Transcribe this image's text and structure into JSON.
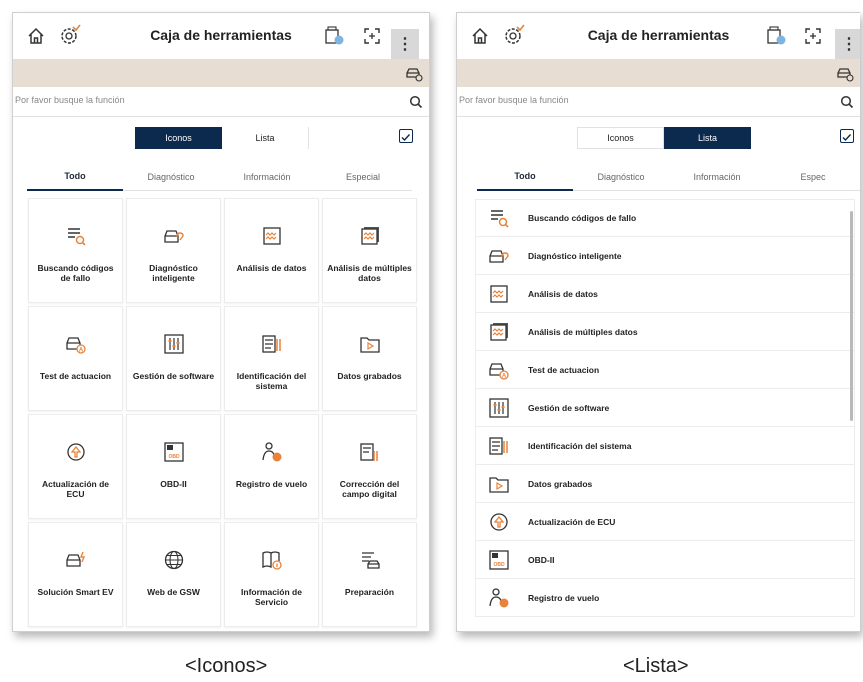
{
  "app": {
    "title": "Caja de herramientas",
    "more_label": "⋮",
    "search_placeholder": "Por favor busque la función"
  },
  "view_toggle": {
    "icons_label": "Iconos",
    "list_label": "Lista"
  },
  "categories": [
    "Todo",
    "Diagnóstico",
    "Información",
    "Especial"
  ],
  "categories_list_view": [
    "Todo",
    "Diagnóstico",
    "Información",
    "Espec"
  ],
  "tools_grid": [
    {
      "label": "Buscando códigos de fallo",
      "icon": "fault-code-search-icon"
    },
    {
      "label": "Diagnóstico inteligente",
      "icon": "smart-diagnosis-icon"
    },
    {
      "label": "Análisis de datos",
      "icon": "data-analysis-icon"
    },
    {
      "label": "Análisis de múltiples datos",
      "icon": "multi-data-icon"
    },
    {
      "label": "Test de actuacion",
      "icon": "actuation-test-icon"
    },
    {
      "label": "Gestión de software",
      "icon": "software-management-icon"
    },
    {
      "label": "Identificación del sistema",
      "icon": "system-id-icon"
    },
    {
      "label": "Datos grabados",
      "icon": "recorded-data-icon"
    },
    {
      "label": "Actualización de ECU",
      "icon": "ecu-update-icon"
    },
    {
      "label": "OBD-II",
      "icon": "obd-icon"
    },
    {
      "label": "Registro de vuelo",
      "icon": "flight-record-icon"
    },
    {
      "label": "Corrección del campo digital",
      "icon": "digital-field-icon"
    },
    {
      "label": "Solución Smart EV",
      "icon": "smart-ev-icon"
    },
    {
      "label": "Web de GSW",
      "icon": "globe-icon"
    },
    {
      "label": "Información de Servicio",
      "icon": "service-info-icon"
    },
    {
      "label": "Preparación",
      "icon": "preparation-icon"
    }
  ],
  "tools_list": [
    {
      "label": "Buscando códigos de fallo",
      "icon": "fault-code-search-icon"
    },
    {
      "label": "Diagnóstico inteligente",
      "icon": "smart-diagnosis-icon"
    },
    {
      "label": "Análisis de datos",
      "icon": "data-analysis-icon"
    },
    {
      "label": "Análisis de múltiples datos",
      "icon": "multi-data-icon"
    },
    {
      "label": "Test de actuacion",
      "icon": "actuation-test-icon"
    },
    {
      "label": "Gestión de software",
      "icon": "software-management-icon"
    },
    {
      "label": "Identificación del sistema",
      "icon": "system-id-icon"
    },
    {
      "label": "Datos grabados",
      "icon": "recorded-data-icon"
    },
    {
      "label": "Actualización de ECU",
      "icon": "ecu-update-icon"
    },
    {
      "label": "OBD-II",
      "icon": "obd-icon"
    },
    {
      "label": "Registro de vuelo",
      "icon": "flight-record-icon"
    }
  ],
  "captions": {
    "icons": "<Iconos>",
    "list": "<Lista>"
  },
  "colors": {
    "navy": "#0b2a4e",
    "orange": "#e8843a",
    "vehicle_band": "#e8ddd2"
  }
}
